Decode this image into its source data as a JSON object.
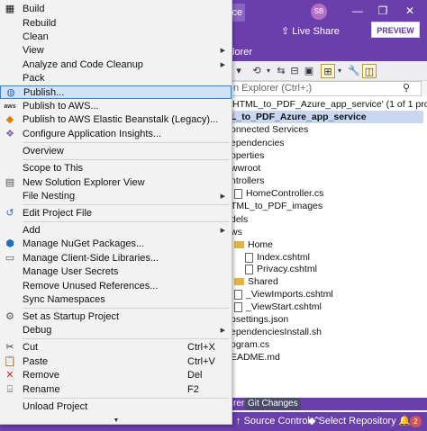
{
  "ide": {
    "title_fragment": "ice",
    "avatar_initials": "SB",
    "live_share": "Live Share",
    "preview": "PREVIEW",
    "se_header_fragment": "lorer",
    "search_placeholder": "n Explorer (Ctrl+;)",
    "tree": [
      {
        "text": "'HTML_to_PDF_Azure_app_service' (1 of 1 project)",
        "kind": "text"
      },
      {
        "text": "L_to_PDF_Azure_app_service",
        "kind": "selected"
      },
      {
        "text": "onnected Services",
        "kind": "text"
      },
      {
        "text": "ependencies",
        "kind": "text"
      },
      {
        "text": "operties",
        "kind": "text"
      },
      {
        "text": "wwroot",
        "kind": "text"
      },
      {
        "text": "ntrollers",
        "kind": "text"
      },
      {
        "text": "HomeController.cs",
        "kind": "file"
      },
      {
        "text": "TML_to_PDF_images",
        "kind": "text"
      },
      {
        "text": "dels",
        "kind": "text"
      },
      {
        "text": "ws",
        "kind": "text"
      },
      {
        "text": "Home",
        "kind": "folder"
      },
      {
        "text": "Index.cshtml",
        "kind": "file"
      },
      {
        "text": "Privacy.cshtml",
        "kind": "file"
      },
      {
        "text": "Shared",
        "kind": "folder"
      },
      {
        "text": "_ViewImports.cshtml",
        "kind": "file"
      },
      {
        "text": "_ViewStart.cshtml",
        "kind": "file"
      },
      {
        "text": "psettings.json",
        "kind": "text"
      },
      {
        "text": "ependenciesInstall.sh",
        "kind": "text"
      },
      {
        "text": "ogram.cs",
        "kind": "text"
      },
      {
        "text": "EADME.md",
        "kind": "text"
      }
    ],
    "tabs": [
      "rer",
      "Git Changes"
    ],
    "status": {
      "source_control": "Source Control",
      "select_repo": "Select Repository",
      "badge": "2"
    }
  },
  "menu": {
    "build": "Build",
    "rebuild": "Rebuild",
    "clean": "Clean",
    "view": "View",
    "analyze": "Analyze and Code Cleanup",
    "pack": "Pack",
    "publish": "Publish...",
    "publish_aws": "Publish to AWS...",
    "publish_beanstalk": "Publish to AWS Elastic Beanstalk (Legacy)...",
    "app_insights": "Configure Application Insights...",
    "overview": "Overview",
    "scope": "Scope to This",
    "new_se_view": "New Solution Explorer View",
    "file_nesting": "File Nesting",
    "edit_project": "Edit Project File",
    "add": "Add",
    "nuget": "Manage NuGet Packages...",
    "client_libs": "Manage Client-Side Libraries...",
    "user_secrets": "Manage User Secrets",
    "remove_unused": "Remove Unused References...",
    "sync_ns": "Sync Namespaces",
    "startup": "Set as Startup Project",
    "debug": "Debug",
    "cut": "Cut",
    "cut_sc": "Ctrl+X",
    "paste": "Paste",
    "paste_sc": "Ctrl+V",
    "remove": "Remove",
    "remove_sc": "Del",
    "rename": "Rename",
    "rename_sc": "F2",
    "unload": "Unload Project"
  }
}
